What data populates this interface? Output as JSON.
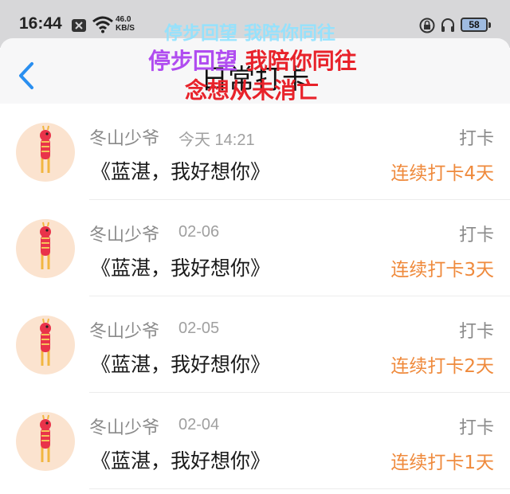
{
  "status_bar": {
    "time": "16:44",
    "net_speed_value": "46.0",
    "net_speed_unit": "KB/S",
    "battery": "58"
  },
  "header": {
    "title": "日常打卡",
    "back_icon": "chevron-left-icon"
  },
  "overlay_caption": {
    "line1": "停步回望 我陪你同往",
    "line2_a": "停步回望",
    "line2_b": "我陪你同往",
    "line3": "念想从未消亡"
  },
  "checkins": [
    {
      "user": "冬山少爷",
      "date": "今天 14:21",
      "content": "《蓝湛，我好想你》",
      "action": "打卡",
      "streak": "连续打卡4天"
    },
    {
      "user": "冬山少爷",
      "date": "02-06",
      "content": "《蓝湛，我好想你》",
      "action": "打卡",
      "streak": "连续打卡3天"
    },
    {
      "user": "冬山少爷",
      "date": "02-05",
      "content": "《蓝湛，我好想你》",
      "action": "打卡",
      "streak": "连续打卡2天"
    },
    {
      "user": "冬山少爷",
      "date": "02-04",
      "content": "《蓝湛，我好想你》",
      "action": "打卡",
      "streak": "连续打卡1天"
    }
  ],
  "colors": {
    "accent_blue": "#2a8ff0",
    "streak_orange": "#ef8a3c",
    "avatar_bg": "#fbe3cf"
  }
}
